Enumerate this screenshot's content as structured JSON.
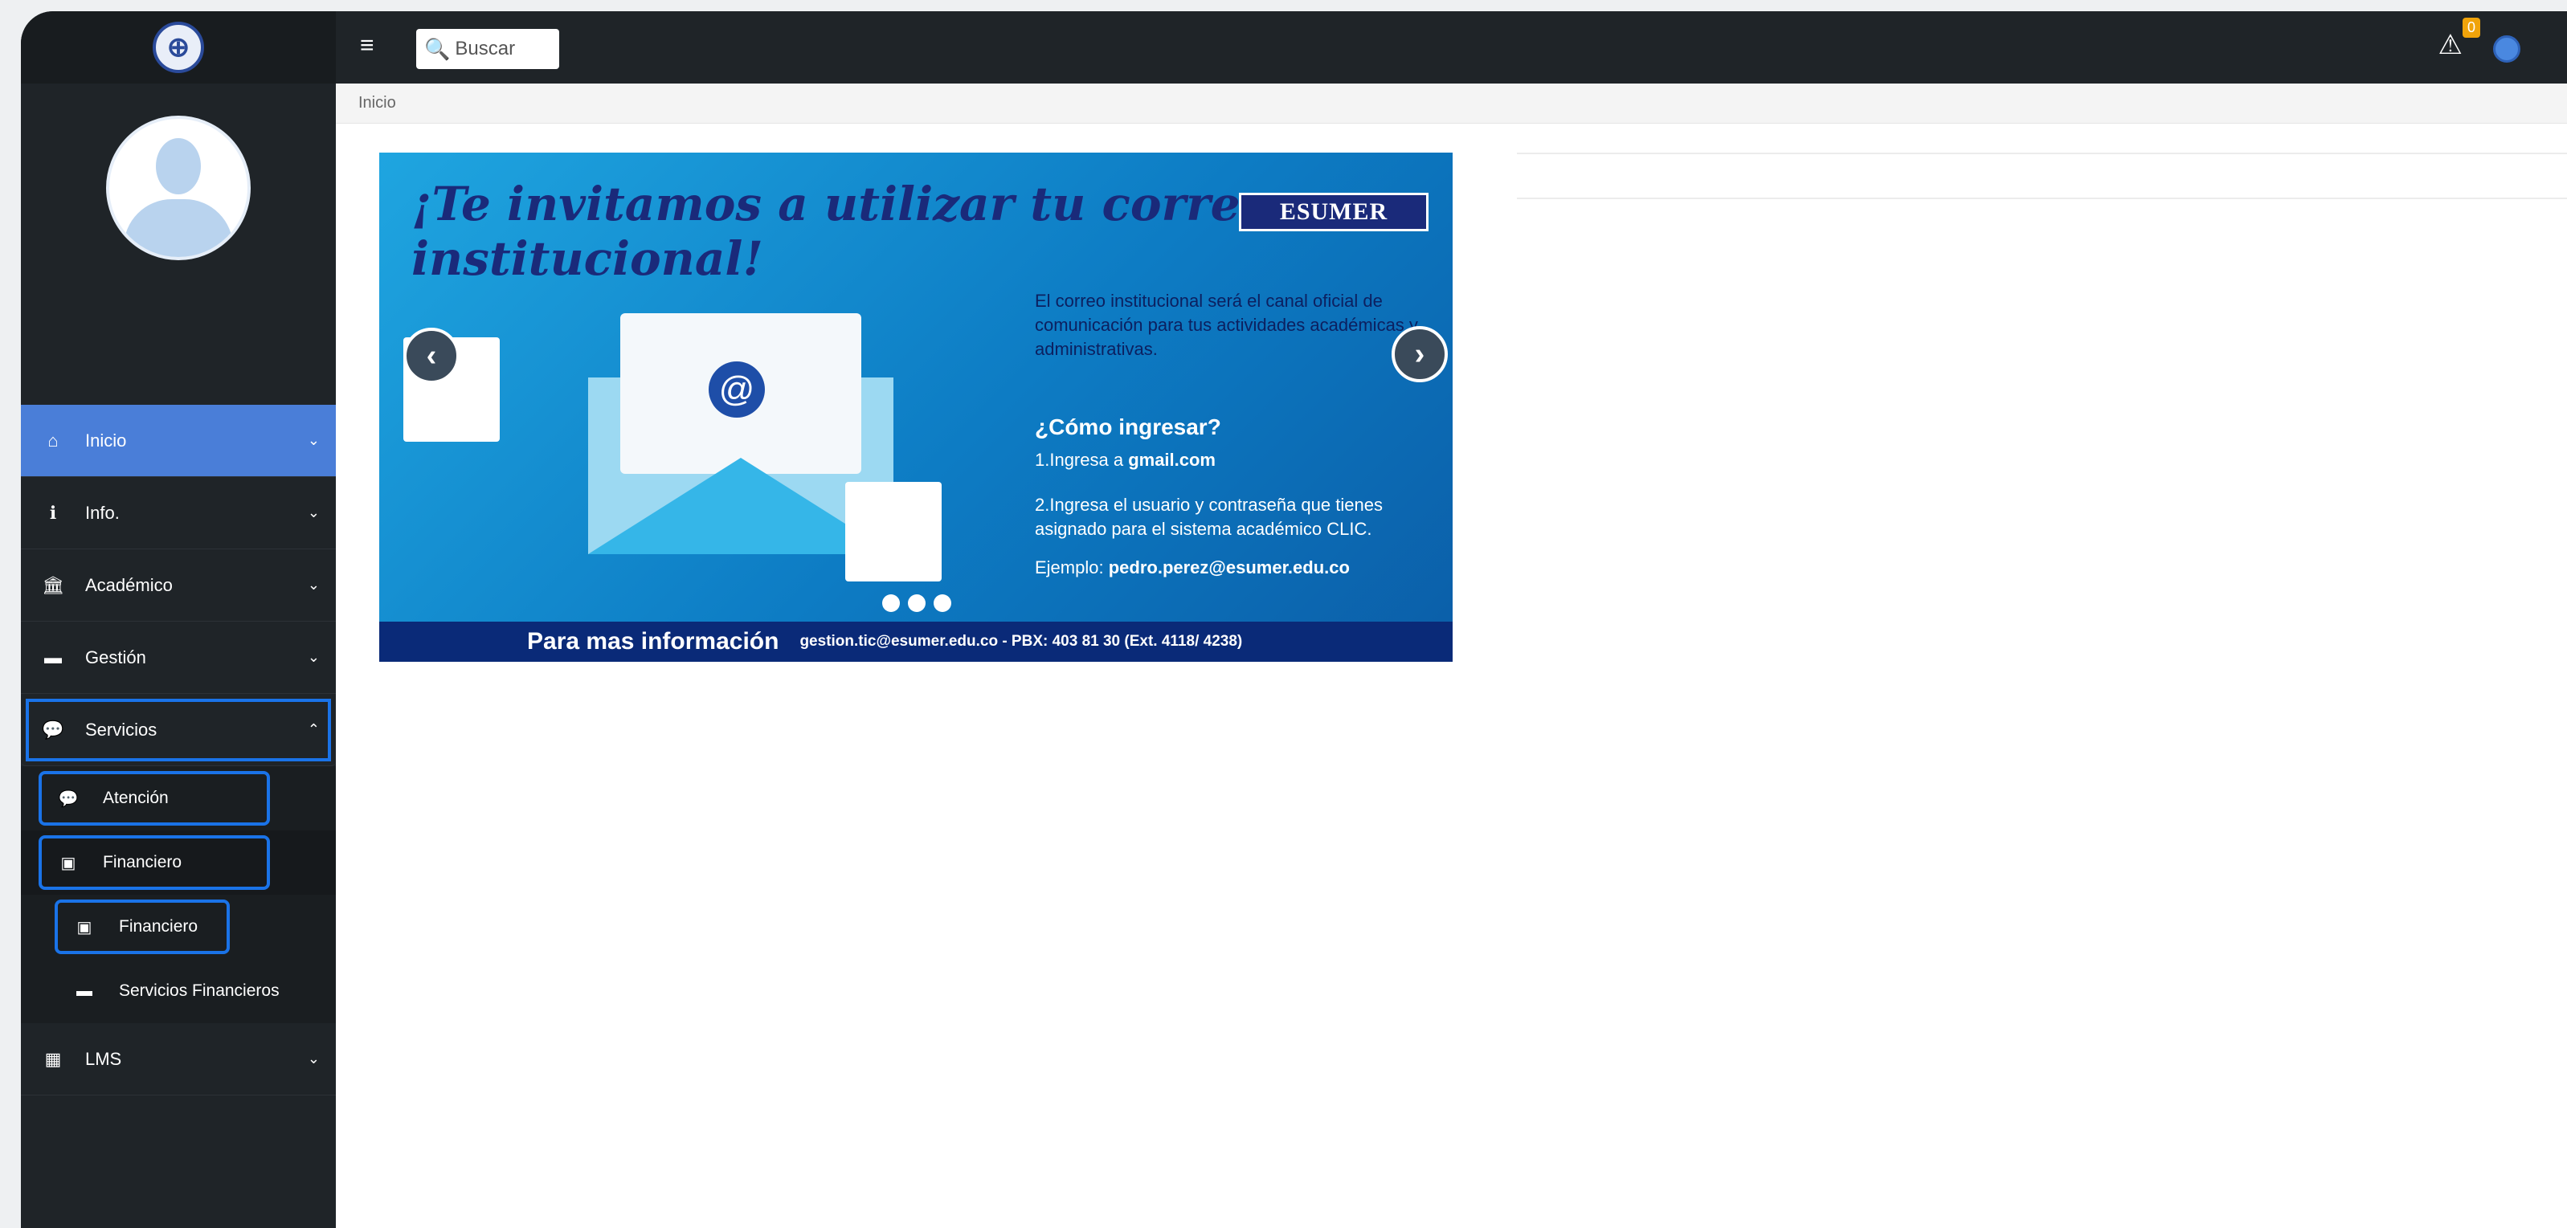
{
  "topbar": {
    "menu_icon": "hamburger-icon",
    "search_placeholder": "Buscar",
    "notification_count": "0"
  },
  "breadcrumb": "Inicio",
  "sidebar": {
    "items": [
      {
        "label": "Inicio",
        "icon": "home-icon"
      },
      {
        "label": "Info.",
        "icon": "info-icon"
      },
      {
        "label": "Académico",
        "icon": "bank-icon"
      },
      {
        "label": "Gestión",
        "icon": "folder-icon"
      },
      {
        "label": "Servicios",
        "icon": "chat-icon"
      },
      {
        "label": "LMS",
        "icon": "grid-icon"
      }
    ],
    "submenu": {
      "atencion": "Atención",
      "financiero": "Financiero",
      "financiero_child": "Financiero",
      "servicios_financieros": "Servicios Financieros"
    }
  },
  "banner": {
    "title": "¡Te invitamos a utilizar tu correo institucional!",
    "brand": "ESUMER",
    "intro": "El correo institucional será el canal oficial de comunicación para tus actividades académicas y administrativas.",
    "heading": "¿Cómo ingresar?",
    "step1_prefix": "1.Ingresa a ",
    "step1_bold": "gmail.com",
    "step2": "2.Ingresa el usuario y contraseña que tienes asignado para el sistema académico CLIC.",
    "example_prefix": "Ejemplo: ",
    "example_bold": "pedro.perez@esumer.edu.co",
    "footer_big": "Para mas información",
    "footer_small": "gestion.tic@esumer.edu.co - PBX: 403 81 30  (Ext. 4118/ 4238)"
  }
}
